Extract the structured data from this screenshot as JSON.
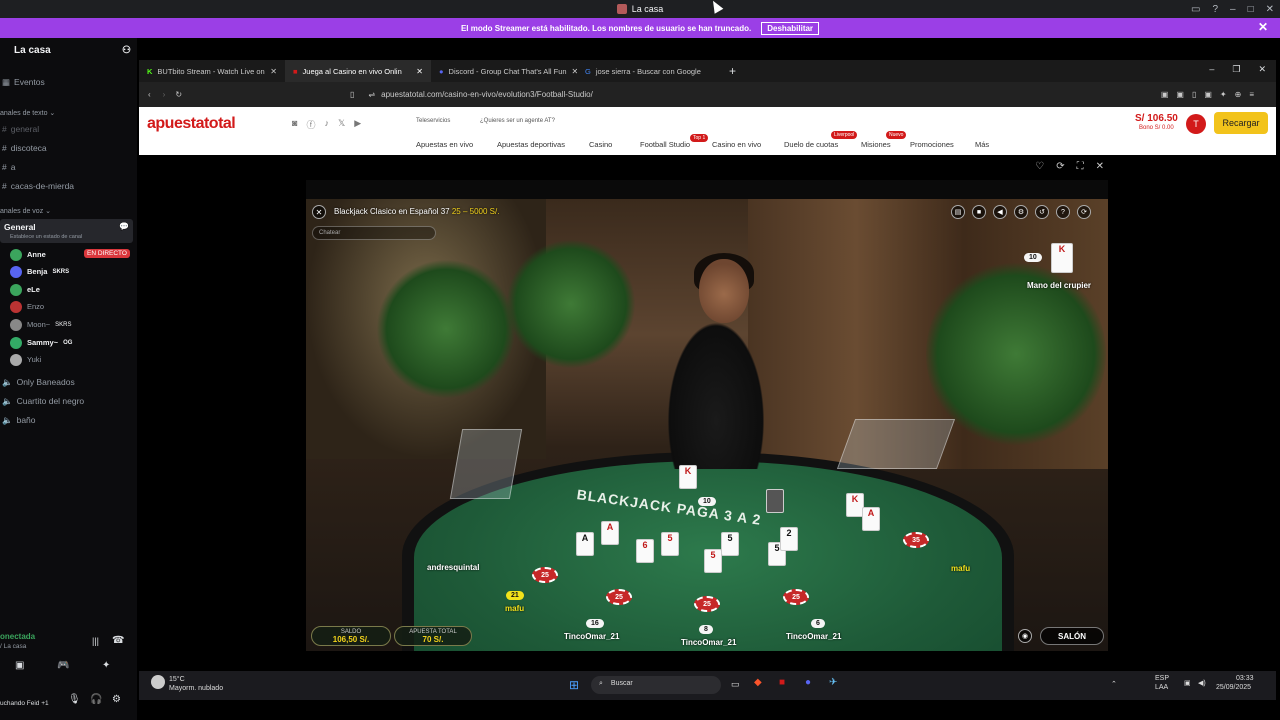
{
  "window": {
    "title": "La casa"
  },
  "streamer": {
    "message": "El modo Streamer está habilitado. Los nombres de usuario se han truncado.",
    "button": "Deshabilitar"
  },
  "sidebar": {
    "server": "La casa",
    "events": "Eventos",
    "text_header": "anales de texto",
    "text_channels": [
      "general",
      "discoteca",
      "a",
      "cacas-de-mierda"
    ],
    "voice_header": "anales de voz",
    "voice_channel": "General",
    "voice_status": "Establece un estado de canal",
    "live_badge": "EN DIRECTO",
    "voice_users": [
      "Anne",
      "Benja",
      "eLe",
      "Enzo",
      "Moon~",
      "Sammy~",
      "Yuki"
    ],
    "user_tags": {
      "benja": "SKRS",
      "moon": "SKRS",
      "sammy": "OG"
    },
    "other_channels": [
      "Only Baneados",
      "Cuartito del negro",
      "baño"
    ],
    "connected": "onectada",
    "connected_sub": "/ La casa",
    "listening": "uchando Feid +1"
  },
  "browser": {
    "tabs": [
      "BUTbito Stream - Watch Live on",
      "Juega al Casino en vivo Onlin",
      "Discord - Group Chat That's All Fun",
      "jose sierra - Buscar con Google"
    ],
    "url": "apuestatotal.com/casino-en-vivo/evolution3/Football-Studio/"
  },
  "site": {
    "logo": "apuestatotal",
    "teleservicios": "Teleservicios",
    "agent": "¿Quieres ser un agente AT?",
    "nav": [
      "Apuestas en vivo",
      "Apuestas deportivas",
      "Casino",
      "Football Studio",
      "Casino en vivo",
      "Duelo de cuotas",
      "Misiones",
      "Promociones",
      "Más"
    ],
    "badges": {
      "football": "Top 1",
      "duelo": "Liverpool",
      "misiones": "Nuevo"
    },
    "balance": "S/ 106.50",
    "bonus": "Bono S/ 0.00",
    "avatar": "T",
    "recharge": "Recargar"
  },
  "game": {
    "title": "Blackjack Clasico en Español 37",
    "limits": "25 – 5000 S/.",
    "chat_placeholder": "Chatear",
    "dealer_label": "Mano del crupier",
    "dealer_score": "10",
    "table_text": "BLACKJACK PAGA 3 A 2",
    "center_score": "10",
    "players": {
      "left": "andresquintal",
      "right": "mafu",
      "mafu2": "mafu",
      "t1": "TincoOmar_21",
      "t2": "TincoOmar_21",
      "t3": "TincoOmar_21"
    },
    "scores": {
      "mafu": "21",
      "t1": "16",
      "t2": "8",
      "t3": "6"
    },
    "chips": [
      "25",
      "25",
      "25",
      "25",
      "25",
      "35",
      "35"
    ],
    "saldo_label": "SALDO",
    "saldo": "106,50 S/.",
    "apuesta_label": "APUESTA TOTAL",
    "apuesta": "70 S/.",
    "salon": "SALÓN"
  },
  "taskbar": {
    "temp": "15°C",
    "weather": "Mayorm. nublado",
    "search": "Buscar",
    "lang": "ESP",
    "lang2": "LAA",
    "time": "03:33",
    "date": "25/09/2025"
  }
}
